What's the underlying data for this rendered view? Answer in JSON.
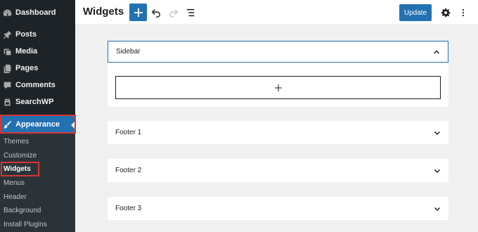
{
  "sidebar": {
    "items": [
      {
        "label": "Dashboard",
        "icon": "dashboard-icon"
      },
      {
        "label": "Posts",
        "icon": "pin-icon"
      },
      {
        "label": "Media",
        "icon": "media-icon"
      },
      {
        "label": "Pages",
        "icon": "pages-icon"
      },
      {
        "label": "Comments",
        "icon": "comments-icon"
      },
      {
        "label": "SearchWP",
        "icon": "searchwp-icon"
      },
      {
        "label": "Appearance",
        "icon": "paintbrush-icon"
      }
    ],
    "submenu": [
      "Themes",
      "Customize",
      "Widgets",
      "Menus",
      "Header",
      "Background",
      "Install Plugins"
    ]
  },
  "header": {
    "title": "Widgets",
    "update_label": "Update"
  },
  "widgets": {
    "sidebar_label": "Sidebar",
    "footers": [
      "Footer 1",
      "Footer 2",
      "Footer 3"
    ]
  },
  "colors": {
    "admin_dark": "#1d2327",
    "accent": "#2271b1",
    "highlight_red": "#d63638"
  }
}
